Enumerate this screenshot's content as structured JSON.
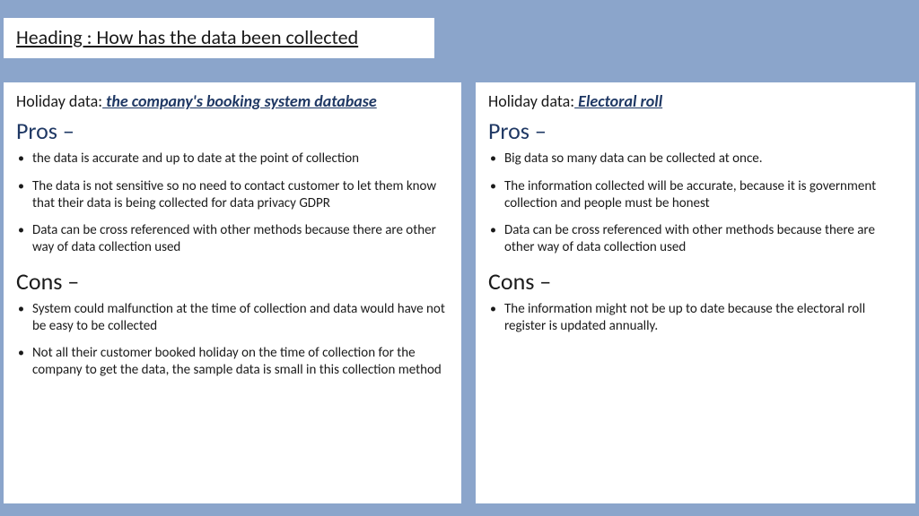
{
  "heading": "Heading   : How has the data been collected",
  "left": {
    "source_prefix": "Holiday data:",
    "source_highlight": " the company's booking system database",
    "pros_label": "Pros –",
    "pros": [
      "the data is accurate and up to date at the point of collection",
      "The data is not sensitive so no need to contact customer to let them know that their data is being collected for data privacy GDPR",
      "Data can be cross referenced with other methods because there are other way of data collection used"
    ],
    "cons_label": "Cons –",
    "cons": [
      "System could malfunction at the time of collection and data would have not be easy to be collected",
      "Not all their customer booked holiday on the time of collection for the company to get the data, the sample data is small in this collection method"
    ]
  },
  "right": {
    "source_prefix": "Holiday data:",
    "source_highlight": " Electoral roll",
    "pros_label": "Pros –",
    "pros": [
      "Big data so many data can be collected at once.",
      "The information collected will be accurate, because it is government collection and people must be honest",
      "Data can be cross referenced with other methods because there are other way of data collection used"
    ],
    "cons_label": "Cons –",
    "cons": [
      "The information might not be up to date because the electoral roll register is updated annually."
    ]
  }
}
